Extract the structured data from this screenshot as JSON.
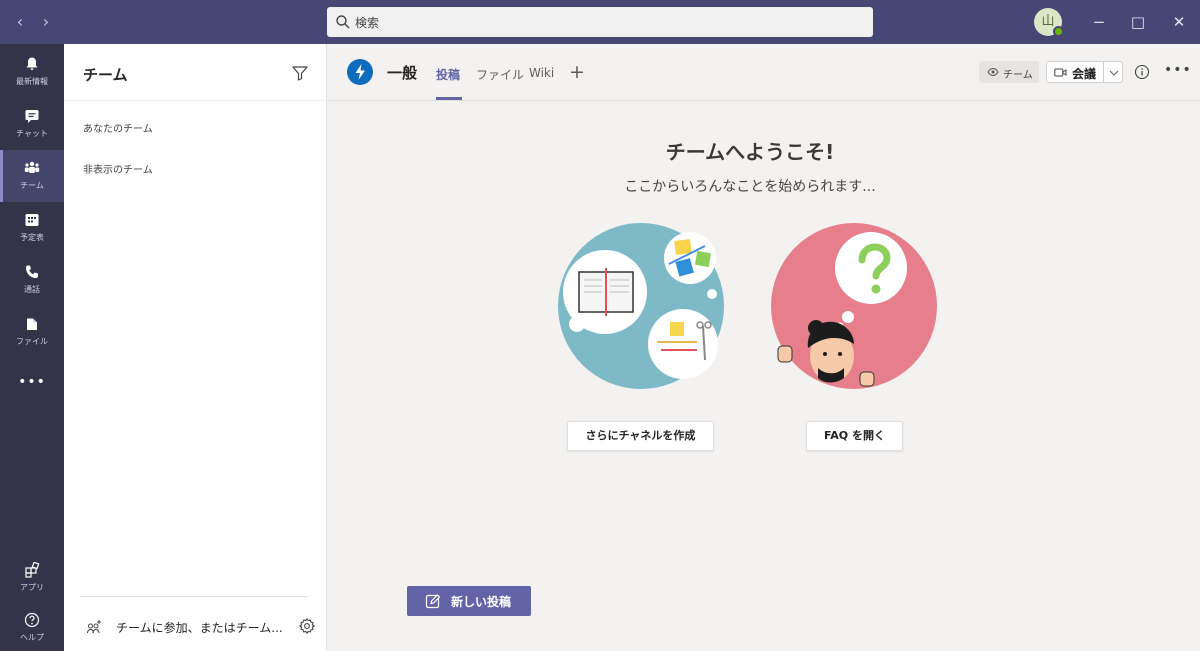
{
  "titlebar": {
    "search_placeholder": "検索",
    "avatar_initial": "山",
    "minimize": "−",
    "maximize": "□",
    "close": "✕",
    "back": "‹",
    "forward": "›"
  },
  "rail": {
    "items": [
      {
        "label": "最新情報",
        "icon": "bell-icon"
      },
      {
        "label": "チャット",
        "icon": "chat-icon"
      },
      {
        "label": "チーム",
        "icon": "teams-icon"
      },
      {
        "label": "予定表",
        "icon": "calendar-icon"
      },
      {
        "label": "通話",
        "icon": "phone-icon"
      },
      {
        "label": "ファイル",
        "icon": "file-icon"
      }
    ],
    "more": "•••",
    "apps_label": "アプリ",
    "help_label": "ヘルプ",
    "accent": "#8b8cc7"
  },
  "teampane": {
    "title": "チーム",
    "your_teams": "あなたのチーム",
    "hidden_teams": "非表示のチーム",
    "join_text": "チームに参加、またはチーム..."
  },
  "channel": {
    "name": "一般",
    "tabs": [
      "投稿",
      "ファイル",
      "Wiki"
    ],
    "add_tab": "+",
    "team_chip": "チーム",
    "meet_label": "会議",
    "more": "•••"
  },
  "welcome": {
    "title": "チームへようこそ!",
    "subtitle": "ここからいろんなことを始められます...",
    "create_channel": "さらにチャネルを作成",
    "open_faq": "FAQ を開く"
  },
  "compose": {
    "new_post": "新しい投稿"
  },
  "colors": {
    "titlebar": "#464775",
    "rail": "#33344a",
    "brand": "#6264a7",
    "illus_blue": "#7db9c7",
    "illus_pink": "#e67f8b"
  }
}
